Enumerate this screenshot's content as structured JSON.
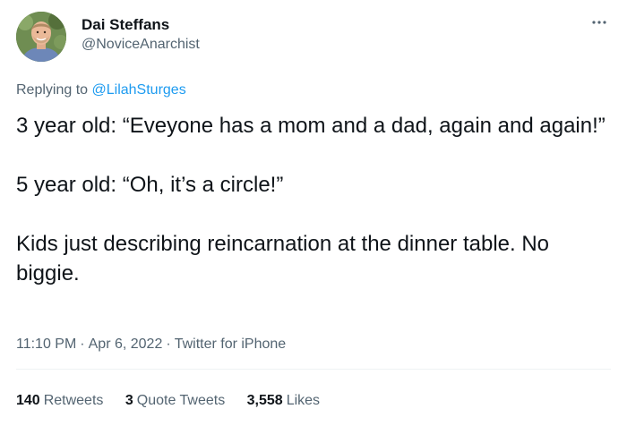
{
  "author": {
    "display_name": "Dai Steffans",
    "handle": "@NoviceAnarchist"
  },
  "more_icon": "more-horizontal-icon",
  "reply": {
    "prefix": "Replying to",
    "mention": "@LilahSturges"
  },
  "tweet": {
    "paragraphs": [
      "3 year old: “Eveyone has a mom and a dad, again and again!”",
      "5 year old: “Oh, it’s a circle!”",
      "Kids just describing reincarnation at the dinner table. No biggie."
    ]
  },
  "meta": {
    "time": "11:10 PM",
    "separator": "·",
    "date": "Apr 6, 2022",
    "source": "Twitter for iPhone"
  },
  "stats": {
    "retweets_count": "140",
    "retweets_label": "Retweets",
    "quotes_count": "3",
    "quotes_label": "Quote Tweets",
    "likes_count": "3,558",
    "likes_label": "Likes"
  },
  "colors": {
    "text": "#0f1419",
    "secondary": "#536471",
    "link": "#1d9bf0",
    "divider": "#eff3f4"
  }
}
